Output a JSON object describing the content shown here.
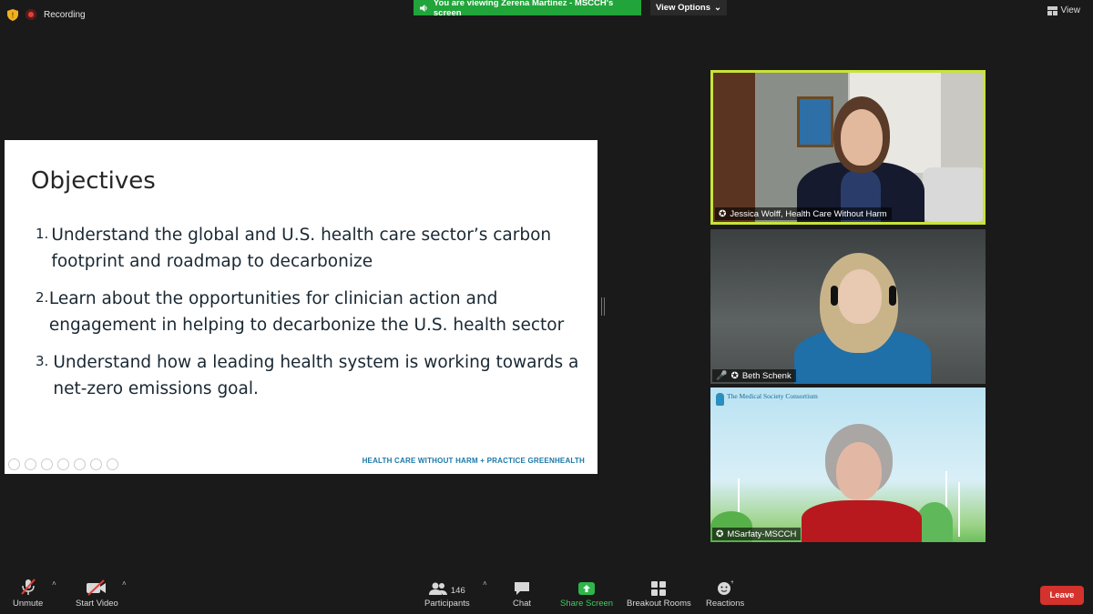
{
  "topbar": {
    "recording_label": "Recording",
    "banner_text": "You are viewing Zerena Martinez - MSCCH's screen",
    "view_options_label": "View Options",
    "view_label": "View"
  },
  "slide": {
    "title": "Objectives",
    "items": [
      {
        "num": "1.",
        "text": "Understand the global and U.S. health care sector’s carbon footprint and roadmap to decarbonize"
      },
      {
        "num": "2.",
        "text": "Learn about the opportunities for clinician action and engagement in helping to decarbonize the U.S. health sector"
      },
      {
        "num": "3.",
        "text": "Understand how a leading health system is working towards a net-zero emissions goal."
      }
    ],
    "footer": "HEALTH CARE WITHOUT HARM + PRACTICE GREENHEALTH"
  },
  "participants_video": [
    {
      "name": "Jessica Wolff, Health Care Without Harm",
      "active": true
    },
    {
      "name": "Beth Schenk",
      "muted": true
    },
    {
      "name": "MSarfaty-MSCCH",
      "logo_text": "The Medical Society Consortium"
    }
  ],
  "toolbar": {
    "unmute_label": "Unmute",
    "start_video_label": "Start Video",
    "participants_label": "Participants",
    "participants_count": "146",
    "chat_label": "Chat",
    "share_screen_label": "Share Screen",
    "breakout_label": "Breakout Rooms",
    "reactions_label": "Reactions",
    "leave_label": "Leave"
  },
  "colors": {
    "banner_green": "#21a43a",
    "active_border": "#c9e33a",
    "leave_red": "#d4322c",
    "slide_footer_blue": "#1b78a8"
  }
}
